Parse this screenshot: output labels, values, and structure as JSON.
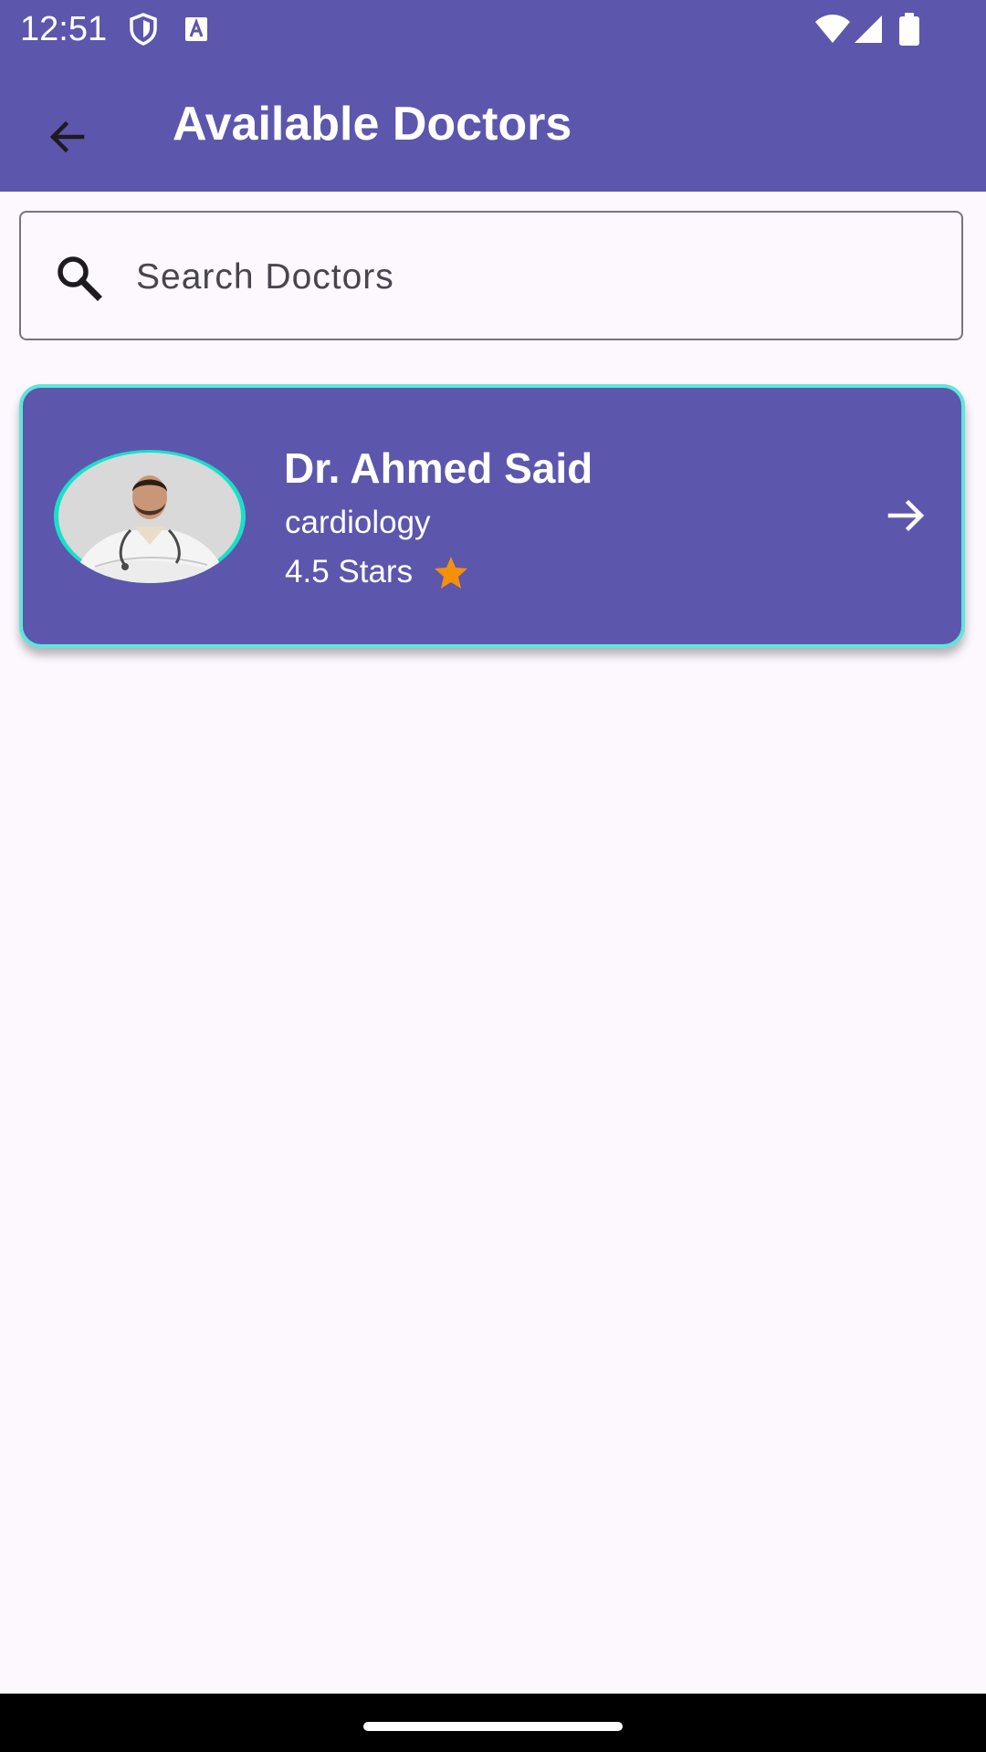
{
  "status_bar": {
    "time": "12:51",
    "icons": [
      "shield-icon",
      "text-a-icon",
      "wifi-icon",
      "signal-icon",
      "battery-icon"
    ]
  },
  "app_bar": {
    "title": "Available Doctors",
    "back_icon": "arrow-back-icon"
  },
  "search": {
    "placeholder": "Search Doctors",
    "value": "",
    "icon": "search-icon"
  },
  "doctors": [
    {
      "name": "Dr. Ahmed Said",
      "specialty": "cardiology",
      "rating_label": "4.5 Stars",
      "rating": 4.5,
      "star_icon": "star-icon",
      "action_icon": "arrow-forward-icon"
    }
  ],
  "colors": {
    "primary": "#5c56ad",
    "card_border": "#5ee6d8",
    "avatar_ring": "#18e0c8",
    "star": "#f4900c",
    "background": "#fdf7fe",
    "on_primary": "#ffffff"
  }
}
